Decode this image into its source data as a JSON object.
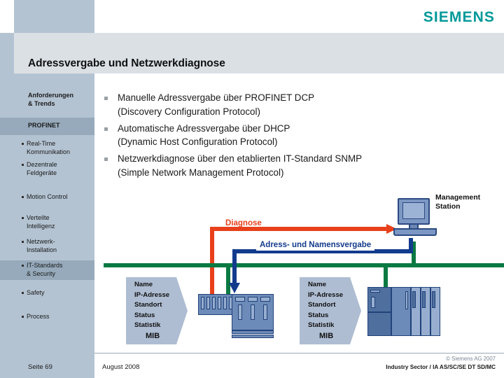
{
  "brand": {
    "logo": "SIEMENS",
    "logo_color": "#009999"
  },
  "header": {
    "title": "Adressvergabe und Netzwerkdiagnose"
  },
  "sidebar": {
    "items": [
      {
        "label": "Anforderungen",
        "label2": "& Trends",
        "type": "head",
        "active": false
      },
      {
        "label": "PROFINET",
        "type": "head",
        "active": true
      },
      {
        "label": "Real-Time",
        "label2": "Kommunikation",
        "type": "sub",
        "active": false
      },
      {
        "label": "Dezentrale",
        "label2": "Feldgeräte",
        "type": "sub",
        "active": false
      },
      {
        "label": "Motion Control",
        "type": "sub",
        "active": false
      },
      {
        "label": "Verteilte",
        "label2": "Intelligenz",
        "type": "sub",
        "active": false
      },
      {
        "label": "Netzwerk-",
        "label2": "Installation",
        "type": "sub",
        "active": false
      },
      {
        "label": "IT-Standards",
        "label2": "& Security",
        "type": "sub",
        "active": true
      },
      {
        "label": "Safety",
        "type": "sub",
        "active": false
      },
      {
        "label": "Process",
        "type": "sub",
        "active": false
      }
    ]
  },
  "content": {
    "bullets": [
      {
        "line1": "Manuelle Adressvergabe über PROFINET DCP",
        "line2": "(Discovery Configuration Protocol)"
      },
      {
        "line1": "Automatische Adressvergabe über DHCP",
        "line2": "(Dynamic Host Configuration Protocol)"
      },
      {
        "line1": "Netzwerkdiagnose über den etablierten IT-Standard SNMP",
        "line2": "(Simple Network Management Protocol)"
      }
    ]
  },
  "diagram": {
    "labels": {
      "diagnose": "Diagnose",
      "address_assignment": "Adress- und Namensvergabe",
      "management_station_line1": "Management",
      "management_station_line2": "Station"
    },
    "colors": {
      "diagnose_arrow": "#e8401a",
      "address_arrow": "#133b8c",
      "network_bus": "#0a7a42",
      "device": "#6d8bb8"
    },
    "callouts": [
      {
        "entries": "Name\nIP-Adresse\nStandort\nStatus\nStatistik",
        "mib": "MIB"
      },
      {
        "entries": "Name\nIP-Adresse\nStandort\nStatus\nStatistik",
        "mib": "MIB"
      }
    ]
  },
  "footer": {
    "page": "Seite 69",
    "date": "August 2008",
    "copyright": "© Siemens AG 2007",
    "organization": "Industry Sector / IA AS/SC/SE DT SD/MC"
  }
}
